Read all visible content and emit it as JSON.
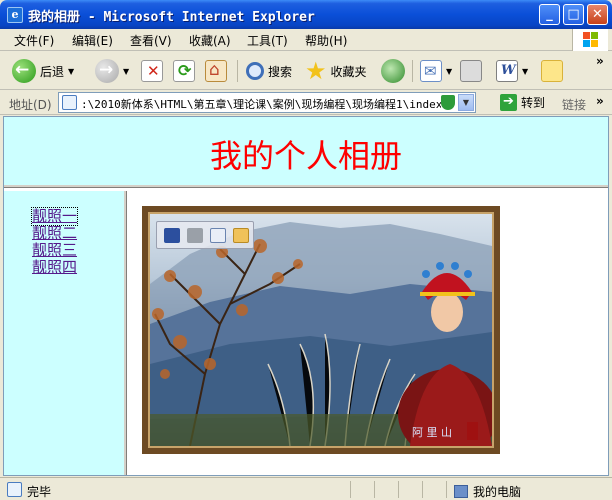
{
  "window": {
    "title": "我的相册 - Microsoft Internet Explorer",
    "minimize": "_",
    "maximize": "□",
    "close": "✕"
  },
  "menu": [
    "文件(F)",
    "编辑(E)",
    "查看(V)",
    "收藏(A)",
    "工具(T)",
    "帮助(H)"
  ],
  "toolbar": {
    "back": "后退",
    "search": "搜索",
    "favorites": "收藏夹",
    "more": "»"
  },
  "address": {
    "label": "地址(D)",
    "value": ":\\2010新体系\\HTML\\第五章\\理论课\\案例\\现场编程\\现场编程1\\index.htm",
    "go": "转到",
    "links": "链接",
    "more": "»"
  },
  "page": {
    "heading": "我的个人相册",
    "links": [
      "靓照一",
      "靓照二",
      "靓照三",
      "靓照四"
    ]
  },
  "status": {
    "text": "完毕",
    "zone": "我的电脑"
  },
  "colors": {
    "heading": "#ff0000",
    "frame_bg": "#ccffff",
    "link": "#551a8b"
  },
  "icons": {
    "image_toolbar": [
      "save-icon",
      "print-icon",
      "mail-icon",
      "folder-icon"
    ]
  }
}
